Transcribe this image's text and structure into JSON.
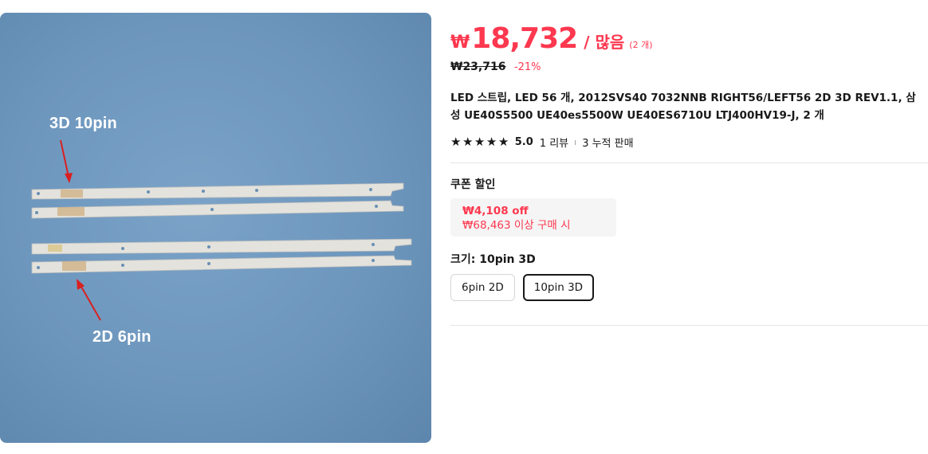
{
  "image": {
    "label_top": "3D 10pin",
    "label_bottom": "2D 6pin"
  },
  "price": {
    "currency": "₩",
    "amount": "18,732",
    "unit": "/ 많음",
    "count": "(2 개)",
    "original": "₩23,716",
    "discount": "-21%"
  },
  "title": "LED 스트립, LED 56 개, 2012SVS40 7032NNB RIGHT56/LEFT56 2D 3D REV1.1, 삼성 UE40S5500 UE40es5500W UE40ES6710U LTJ400HV19-J, 2 개",
  "rating": {
    "stars": 5,
    "score": "5.0",
    "reviews": "1 리뷰",
    "separator": "ı",
    "sold": "3 누적 판매"
  },
  "coupon": {
    "heading": "쿠폰 할인",
    "off": "₩4,108 off",
    "condition": "₩68,463 이상 구매 시"
  },
  "size": {
    "heading": "크기: 10pin 3D",
    "options": [
      {
        "label": "6pin 2D",
        "selected": false
      },
      {
        "label": "10pin 3D",
        "selected": true
      }
    ]
  },
  "colors": {
    "accent": "#fd384f",
    "image_bg": "#6f98bf",
    "text": "#191919"
  }
}
